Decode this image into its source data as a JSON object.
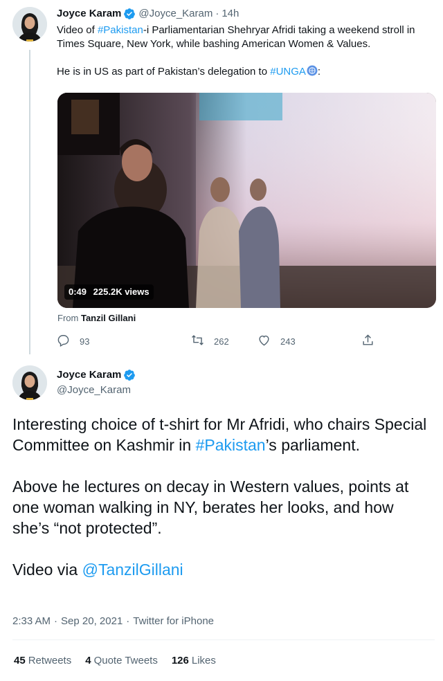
{
  "tweet1": {
    "author_name": "Joyce Karam",
    "handle": "@Joyce_Karam",
    "separator": "·",
    "time": "14h",
    "line1_prefix": "Video of ",
    "line1_hashtag": "#Pakistan",
    "line1_suffix": "-i Parliamentarian Shehryar Afridi taking a weekend stroll in Times Square, New York, while bashing American Women & Values.",
    "line2_prefix": "He is in US as part of Pakistan’s delegation to ",
    "line2_hashtag": "#UNGA",
    "line2_suffix": ":",
    "video": {
      "duration": "0:49",
      "views": "225.2K views"
    },
    "from_label": "From",
    "from_name": "Tanzil Gillani",
    "replies": "93",
    "retweets": "262",
    "likes": "243"
  },
  "tweet2": {
    "author_name": "Joyce Karam",
    "handle": "@Joyce_Karam",
    "p1_prefix": "Interesting choice of t-shirt for Mr Afridi, who chairs Special Committee on Kashmir in ",
    "p1_hashtag": "#Pakistan",
    "p1_suffix": "’s parliament.",
    "p2": "Above he lectures on decay in Western values, points at one woman walking in NY, berates her looks, and how she’s “not protected”.",
    "p3_prefix": "Video via ",
    "p3_mention": "@TanzilGillani",
    "meta_time": "2:33 AM",
    "meta_date": "Sep 20, 2021",
    "meta_source": "Twitter for iPhone",
    "meta_sep": "·",
    "stats": {
      "retweets_count": "45",
      "retweets_label": "Retweets",
      "quotes_count": "4",
      "quotes_label": "Quote Tweets",
      "likes_count": "126",
      "likes_label": "Likes"
    }
  },
  "colors": {
    "link": "#1d9bf0",
    "verified": "#1d9bf0",
    "secondary_text": "#536471"
  },
  "icons": [
    "verified-badge-icon",
    "reply-icon",
    "retweet-icon",
    "like-icon",
    "share-icon",
    "un-flag-icon"
  ]
}
